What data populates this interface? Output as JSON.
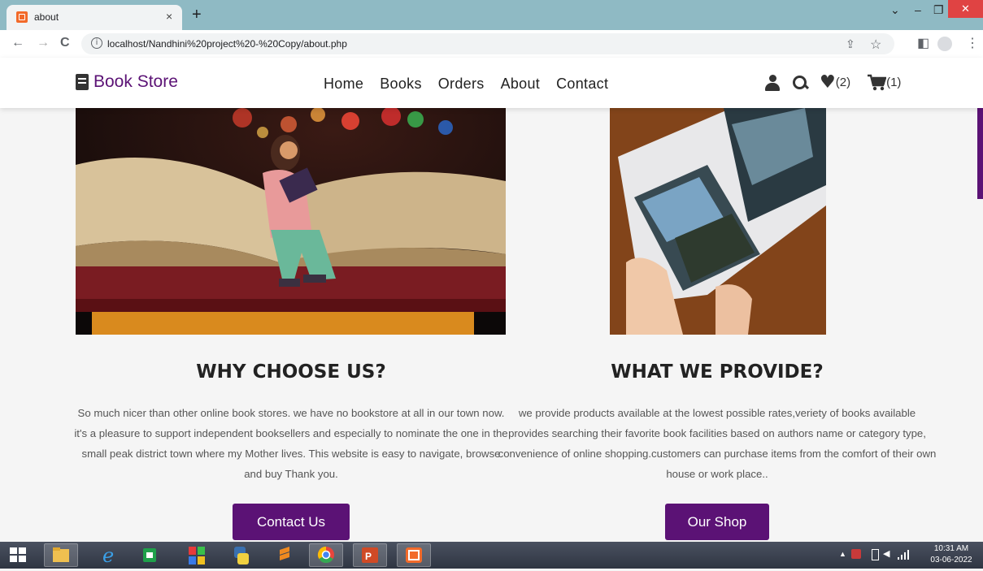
{
  "browser": {
    "tab_title": "about",
    "tab_close": "×",
    "new_tab": "+",
    "url": "localhost/Nandhini%20project%20-%20Copy/about.php",
    "info": "i",
    "controls": {
      "dropdown": "⌄",
      "minimize": "–",
      "restore": "❐",
      "close": "✕"
    },
    "nav": {
      "back": "←",
      "forward": "→",
      "reload": "C"
    },
    "toolbar": {
      "share": "⇪",
      "star": "☆",
      "sidepanel": "◧",
      "menu": "⋮"
    }
  },
  "site": {
    "logo": "Book Store",
    "menu": [
      "Home",
      "Books",
      "Orders",
      "About",
      "Contact"
    ],
    "wishlist_count": "(2)",
    "cart_count": "(1)",
    "accent_color": "#5b1275"
  },
  "sections": {
    "left": {
      "title": "WHY CHOOSE US?",
      "text": "So much nicer than other online book stores. we have no bookstore at all in our town now. it's a pleasure to support independent booksellers and especially to nominate the one in the small peak district town where my Mother lives. This website is easy to navigate, browse and buy Thank you.",
      "button": "Contact Us"
    },
    "right": {
      "title": "WHAT WE PROVIDE?",
      "text": "we provide products available at the lowest possible rates,veriety of books available provides searching their favorite book facilities based on authors name or category type, convenience of online shopping.customers can purchase items from the comfort of their own house or work place..",
      "button": "Our Shop"
    }
  },
  "taskbar": {
    "time": "10:31 AM",
    "date": "03-06-2022"
  }
}
